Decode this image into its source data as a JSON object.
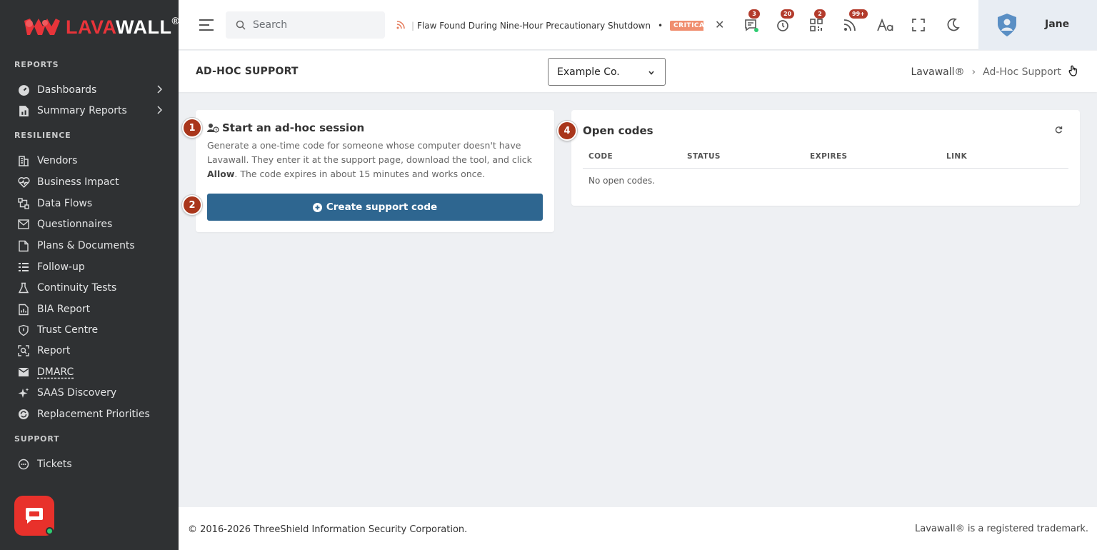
{
  "brand": {
    "logo_text_red": "LAVA",
    "logo_text_white": "WALL",
    "logo_mark": "®"
  },
  "sidebar": {
    "sections": [
      {
        "title": "REPORTS"
      },
      {
        "title": "RESILIENCE"
      },
      {
        "title": "SUPPORT"
      }
    ],
    "items": [
      {
        "label": "Dashboards",
        "icon": "gauge-icon"
      },
      {
        "label": "Summary Reports",
        "icon": "report-icon"
      },
      {
        "label": "Vendors",
        "icon": "building-icon"
      },
      {
        "label": "Business Impact",
        "icon": "heartbeat-icon"
      },
      {
        "label": "Data Flows",
        "icon": "flow-icon"
      },
      {
        "label": "Questionnaires",
        "icon": "envelope-icon"
      },
      {
        "label": "Plans & Documents",
        "icon": "document-icon"
      },
      {
        "label": "Follow-up",
        "icon": "list-icon"
      },
      {
        "label": "Continuity Tests",
        "icon": "flask-icon"
      },
      {
        "label": "BIA Report",
        "icon": "chart-icon"
      },
      {
        "label": "Trust Centre",
        "icon": "shield-icon"
      },
      {
        "label": "Report",
        "icon": "search-report-icon"
      },
      {
        "label": "DMARC",
        "icon": "mail-check-icon"
      },
      {
        "label": "SAAS Discovery",
        "icon": "sparkle-icon"
      },
      {
        "label": "Replacement Priorities",
        "icon": "cycle-icon"
      },
      {
        "label": "Tickets",
        "icon": "ticket-icon"
      }
    ]
  },
  "topbar": {
    "search_placeholder": "Search",
    "ticker_text": "Flaw Found During Nine-Hour Precautionary Shutdown",
    "ticker_badge": "CRITICAL",
    "badges": {
      "messages": "3",
      "alerts": "20",
      "qr": "2",
      "feed": "99+"
    },
    "user_name": "Jane"
  },
  "header": {
    "title": "AD-HOC SUPPORT",
    "company": "Example Co.",
    "breadcrumb_root": "Lavawall®",
    "breadcrumb_sep": "›",
    "breadcrumb_current": "Ad-Hoc Support"
  },
  "session_card": {
    "step1": "1",
    "step2": "2",
    "title": "Start an ad-hoc session",
    "desc_part1": "Generate a one-time code for someone whose computer doesn't have Lavawall. They enter it at the support page, download the tool, and click ",
    "desc_bold": "Allow",
    "desc_part2": ". The code expires in about 15 minutes and works once.",
    "button_label": "Create support code"
  },
  "codes_card": {
    "step": "4",
    "title": "Open codes",
    "columns": [
      "CODE",
      "STATUS",
      "EXPIRES",
      "LINK"
    ],
    "empty_text": "No open codes."
  },
  "footer": {
    "copyright": "© 2016-2026 ThreeShield Information Security Corporation.",
    "trademark": "Lavawall® is a registered trademark."
  }
}
